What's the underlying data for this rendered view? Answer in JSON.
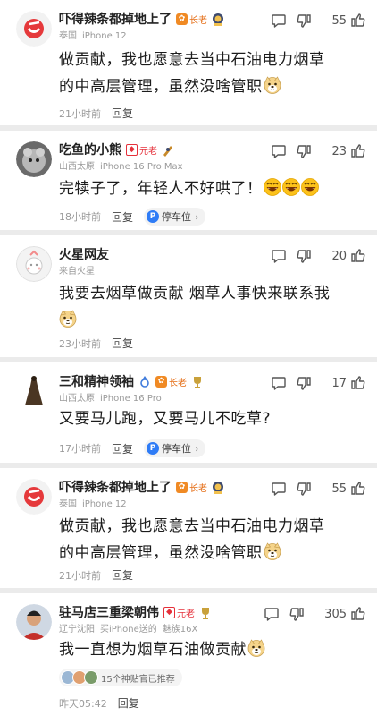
{
  "comments": [
    {
      "user": "吓得辣条都掉地上了",
      "badge": "长老",
      "meta": [
        "泰国",
        "iPhone 12"
      ],
      "likes": "55",
      "text1": "做贡献，我也愿意去当中石油电力烟草",
      "text2": "的中高层管理，虽然没啥管职",
      "time": "21小时前",
      "reply": "回复"
    },
    {
      "user": "吃鱼的小熊",
      "badge": "元老",
      "meta": [
        "山西太原",
        "iPhone 16 Pro Max"
      ],
      "likes": "23",
      "text1": "完犊子了，年轻人不好哄了！",
      "time": "18小时前",
      "reply": "回复",
      "parking": "停车位"
    },
    {
      "user": "火星网友",
      "meta": [
        "来自火星"
      ],
      "likes": "20",
      "text1": "我要去烟草做贡献 烟草人事快来联系我",
      "time": "23小时前",
      "reply": "回复"
    },
    {
      "user": "三和精神领袖",
      "badge": "长老",
      "meta": [
        "山西太原",
        "iPhone 16 Pro"
      ],
      "likes": "17",
      "text1": "又要马儿跑，又要马儿不吃草?",
      "time": "17小时前",
      "reply": "回复",
      "parking": "停车位"
    },
    {
      "user": "吓得辣条都掉地上了",
      "badge": "长老",
      "meta": [
        "泰国",
        "iPhone 12"
      ],
      "likes": "55",
      "text1": "做贡献，我也愿意去当中石油电力烟草",
      "text2": "的中高层管理，虽然没啥管职",
      "time": "21小时前",
      "reply": "回复"
    },
    {
      "user": "驻马店三重梁朝伟",
      "badge": "元老",
      "meta": [
        "辽宁沈阳",
        "买iPhone送的",
        "魅族16X"
      ],
      "likes": "305",
      "text1": "我一直想为烟草石油做贡献",
      "recommend": "15个神贴官已推荐",
      "time": "昨天05:42",
      "reply": "回复"
    }
  ],
  "colors": {
    "background": "#ebebeb",
    "card": "#ffffff",
    "badge_orange": "#f08a24",
    "badge_red": "#e5303a",
    "parking_blue": "#2f7cf6"
  }
}
